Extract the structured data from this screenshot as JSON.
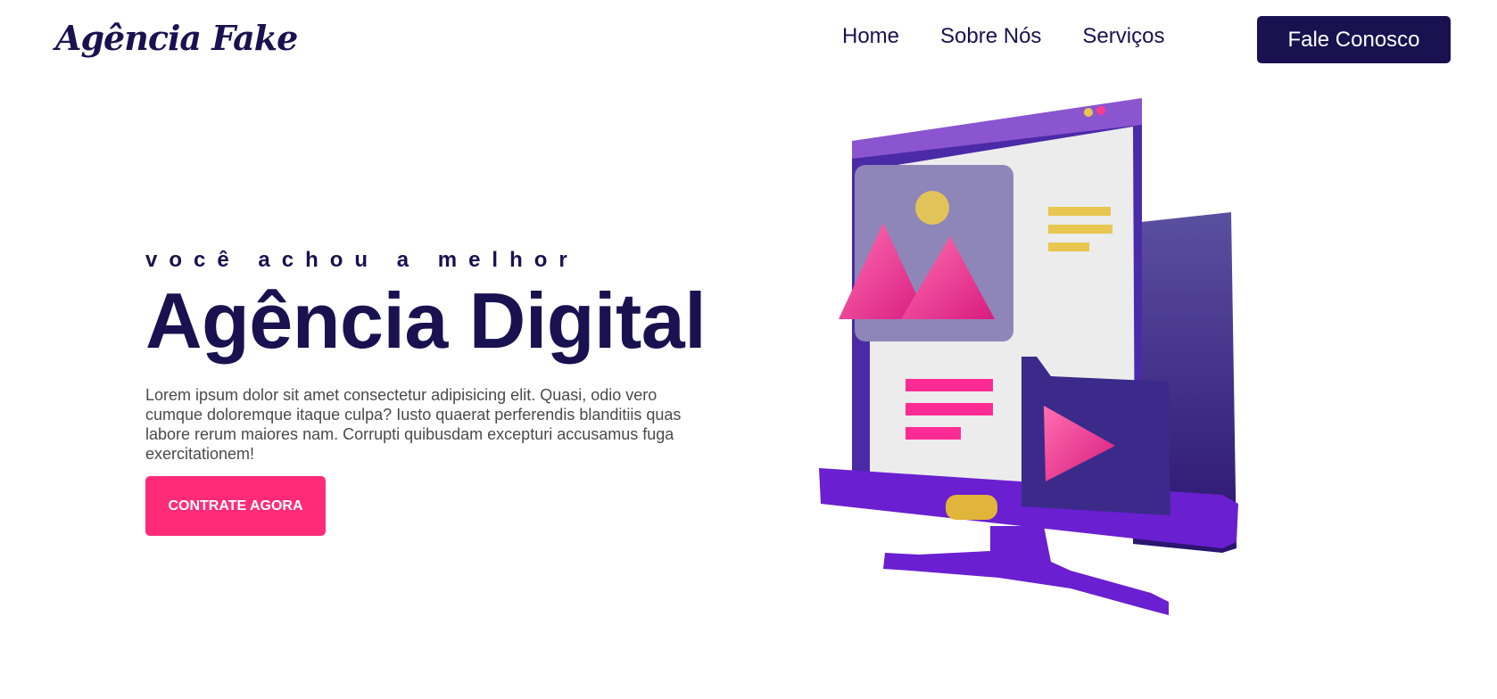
{
  "header": {
    "logo_text": "Agência Fake",
    "nav": [
      {
        "label": "Home"
      },
      {
        "label": "Sobre Nós"
      },
      {
        "label": "Serviços"
      }
    ],
    "cta_label": "Fale Conosco"
  },
  "hero": {
    "eyebrow": "você achou a melhor",
    "headline": "Agência Digital",
    "lead": "Lorem ipsum dolor sit amet consectetur adipisicing elit. Quasi, odio vero cumque doloremque itaque culpa? Iusto quaerat perferendis blanditiis quas labore rerum maiores nam. Corrupti quibusdam excepturi accusamus fuga exercitationem!",
    "cta_label": "CONTRATE AGORA"
  },
  "colors": {
    "brand_navy": "#1a1150",
    "accent_pink": "#ff2b79",
    "illustration_purple": "#6a1fd0",
    "illustration_gold": "#e8c64f"
  },
  "illustration": {
    "icon": "computer-monitor-3d-illustration"
  }
}
